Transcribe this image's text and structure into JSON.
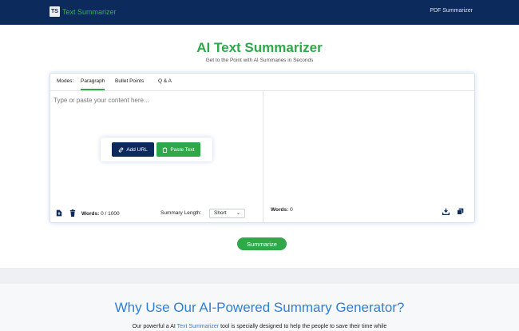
{
  "header": {
    "logo_text": "TS",
    "brand": "Text Summarizer",
    "nav_link": "PDF Summarizer"
  },
  "hero": {
    "title": "AI Text Summarizer",
    "subtitle": "Get to the Point with AI Summaries in Seconds"
  },
  "modes": {
    "label": "Modes:",
    "tabs": [
      {
        "label": "Paragraph",
        "active": true
      },
      {
        "label": "Bullet Points",
        "active": false
      },
      {
        "label": "Q & A",
        "active": false
      }
    ]
  },
  "editor": {
    "placeholder": "Type or paste your content here..."
  },
  "actions": {
    "add_url": "Add URL",
    "paste_text": "Paste Text"
  },
  "input_footer": {
    "words_label": "Words:",
    "words_value": "0 / 1000",
    "summary_length_label": "Summary Length:",
    "summary_length_value": "Short"
  },
  "output_footer": {
    "words_label": "Words:",
    "words_value": "0"
  },
  "summarize_button": "Summarize",
  "why": {
    "title": "Why Use Our AI-Powered Summary Generator?",
    "text_before": "Our powerful a AI ",
    "text_link": "Text Summarizer",
    "text_after": " tool is specially designed to help the people to save their time while"
  },
  "colors": {
    "navy": "#0d2a5c",
    "green": "#2fa84a",
    "blue": "#2f7fd6"
  }
}
